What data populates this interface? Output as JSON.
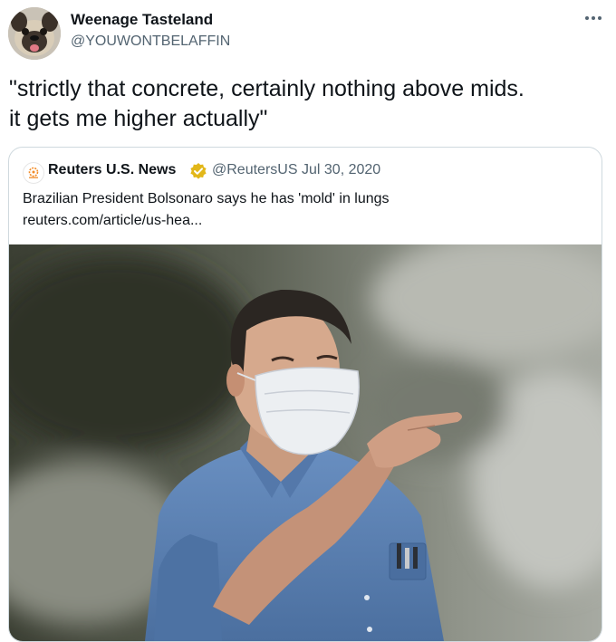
{
  "tweet": {
    "author_name": "Weenage Tasteland",
    "author_handle": "@YOUWONTBELAFFIN",
    "avatar_icon": "pug-avatar",
    "more_icon": "more-options-icon",
    "text_lines": [
      "\"strictly that concrete, certainly nothing above mids.",
      "it gets me higher actually\""
    ]
  },
  "quoted_tweet": {
    "author_name": "Reuters U.S. News",
    "author_handle": "@ReutersUS",
    "date": "Jul 30, 2020",
    "verified_icon": "verified-badge-icon",
    "logo_icon": "reuters-logo",
    "text": "Brazilian President Bolsonaro says he has 'mold' in lungs",
    "link": "reuters.com/article/us-hea...",
    "image_description_icon": "news-photo",
    "colors": {
      "verified_badge": "#e2b719",
      "shirt": "#5b82b5",
      "mask": "#e9ecf0"
    }
  }
}
